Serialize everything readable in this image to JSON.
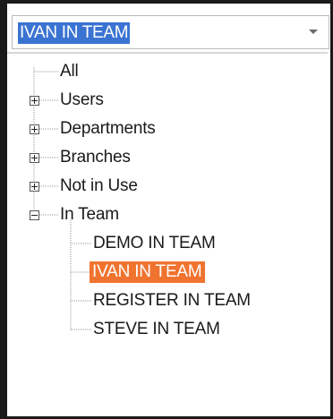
{
  "combo": {
    "value": "IVAN IN TEAM"
  },
  "tree": {
    "root": {
      "label": "All",
      "icon": "tree-root"
    },
    "groups": [
      {
        "label": "Users",
        "expanded": false,
        "toggle_icon": "plus-box-icon"
      },
      {
        "label": "Departments",
        "expanded": false,
        "toggle_icon": "plus-box-icon"
      },
      {
        "label": "Branches",
        "expanded": false,
        "toggle_icon": "plus-box-icon"
      },
      {
        "label": "Not in Use",
        "expanded": false,
        "toggle_icon": "plus-box-icon"
      },
      {
        "label": "In Team",
        "expanded": true,
        "toggle_icon": "minus-box-icon"
      }
    ],
    "team_items": [
      {
        "label": "DEMO IN TEAM",
        "selected": false
      },
      {
        "label": "IVAN IN TEAM",
        "selected": true
      },
      {
        "label": "REGISTER IN TEAM",
        "selected": false
      },
      {
        "label": "STEVE IN TEAM",
        "selected": false
      }
    ]
  },
  "colors": {
    "selection": "#f0732f",
    "combo_highlight": "#3b73d2",
    "text": "#1a1a1a",
    "tree_lines": "#9a9a9a"
  }
}
